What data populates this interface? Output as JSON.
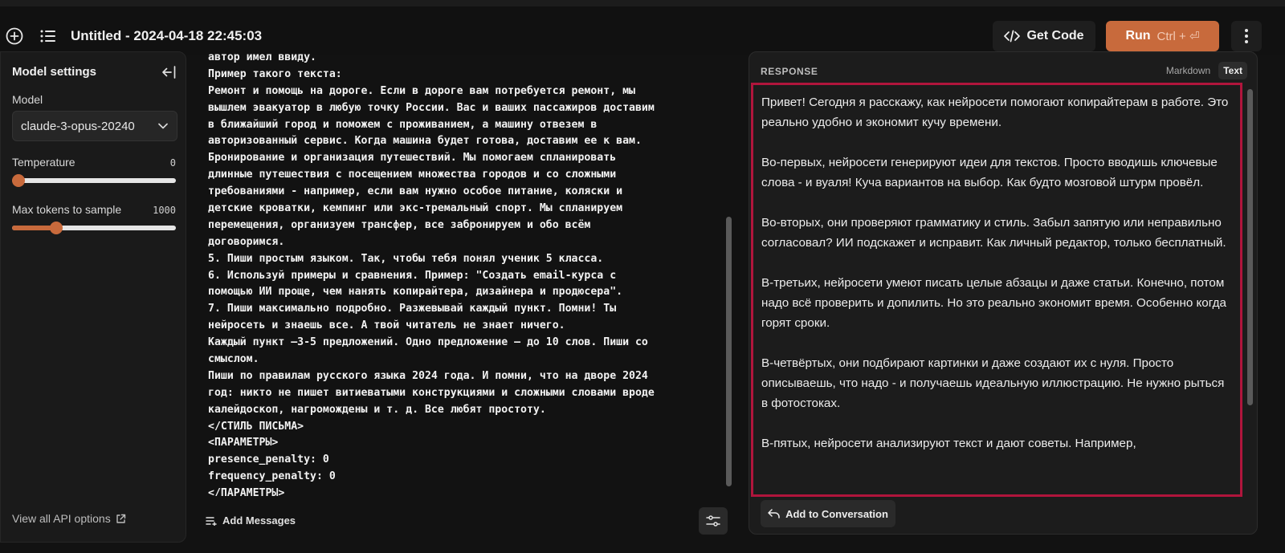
{
  "header": {
    "title": "Untitled - 2024-04-18 22:45:03",
    "get_code_label": "Get Code",
    "run_label": "Run",
    "run_shortcut": "Ctrl + ⏎",
    "accent_color": "#c86a3c"
  },
  "settings": {
    "title": "Model settings",
    "model_label": "Model",
    "model_value": "claude-3-opus-20240",
    "temperature_label": "Temperature",
    "temperature_value": "0",
    "temperature_fraction": 0.0,
    "max_tokens_label": "Max tokens to sample",
    "max_tokens_value": "1000",
    "max_tokens_fraction": 0.27,
    "api_link": "View all API options"
  },
  "prompt": {
    "lines": [
      "автор имел ввиду.",
      "Пример такого текста:",
      "Ремонт и помощь на дороге. Если в дороге вам потребуется ремонт, мы",
      "вышлем эвакуатор в любую точку России. Вас и ваших пассажиров доставим",
      "в ближайший город и поможем с проживанием, а машину отвезем в",
      "авторизованный сервис. Когда машина будет готова, доставим ее к вам.",
      "Бронирование и организация путешествий. Мы помогаем спланировать",
      "длинные путешествия с посещением множества городов и со сложными",
      "требованиями - например, если вам нужно особое питание, коляски и",
      "детские кроватки, кемпинг или экс-тремальный спорт. Мы спланируем",
      "перемещения, организуем трансфер, все забронируем и обо всём",
      "договоримся.",
      "5. Пиши простым языком. Так, чтобы тебя понял ученик 5 класса.",
      "6. Используй примеры и сравнения. Пример: \"Создать email-курса с",
      "помощью ИИ проще, чем нанять копирайтера, дизайнера и продюсера\".",
      "7. Пиши максимально подробно. Разжевывай каждый пункт. Помни! Ты",
      "нейросеть и знаешь все. А твой читатель не знает ничего.",
      "Каждый пункт —3-5 предложений. Одно предложение — до 10 слов. Пиши со",
      "смыслом.",
      "Пиши по правилам русского языка 2024 года. И помни, что на дворе 2024",
      "год: никто не пишет витиеватыми конструкциями и сложными словами вроде",
      "калейдоскоп, нагромождены и т. д. Все любят простоту.",
      "</СТИЛЬ ПИСЬМА>",
      "<ПАРАМЕТРЫ>",
      "presence_penalty: 0",
      "frequency_penalty: 0",
      "</ПАРАМЕТРЫ>"
    ],
    "add_messages_label": "Add Messages"
  },
  "response": {
    "title": "RESPONSE",
    "tab_markdown": "Markdown",
    "tab_text": "Text",
    "paragraphs": [
      "Привет! Сегодня я расскажу, как нейросети помогают копирайтерам в работе. Это реально удобно и экономит кучу времени.",
      "Во-первых, нейросети генерируют идеи для текстов. Просто вводишь ключевые слова - и вуаля! Куча вариантов на выбор. Как будто мозговой штурм провёл.",
      "Во-вторых, они проверяют грамматику и стиль. Забыл запятую или неправильно согласовал? ИИ подскажет и исправит. Как личный редактор, только бесплатный.",
      "В-третьих, нейросети умеют писать целые абзацы и даже статьи. Конечно, потом надо всё проверить и допилить. Но это реально экономит время. Особенно когда горят сроки.",
      "В-четвёртых, они подбирают картинки и даже создают их с нуля. Просто описываешь, что надо - и получаешь идеальную иллюстрацию. Не нужно рыться в фотостоках.",
      "В-пятых, нейросети анализируют текст и дают советы. Например,"
    ],
    "add_conversation_label": "Add to Conversation",
    "highlight_color": "#b0153c"
  }
}
